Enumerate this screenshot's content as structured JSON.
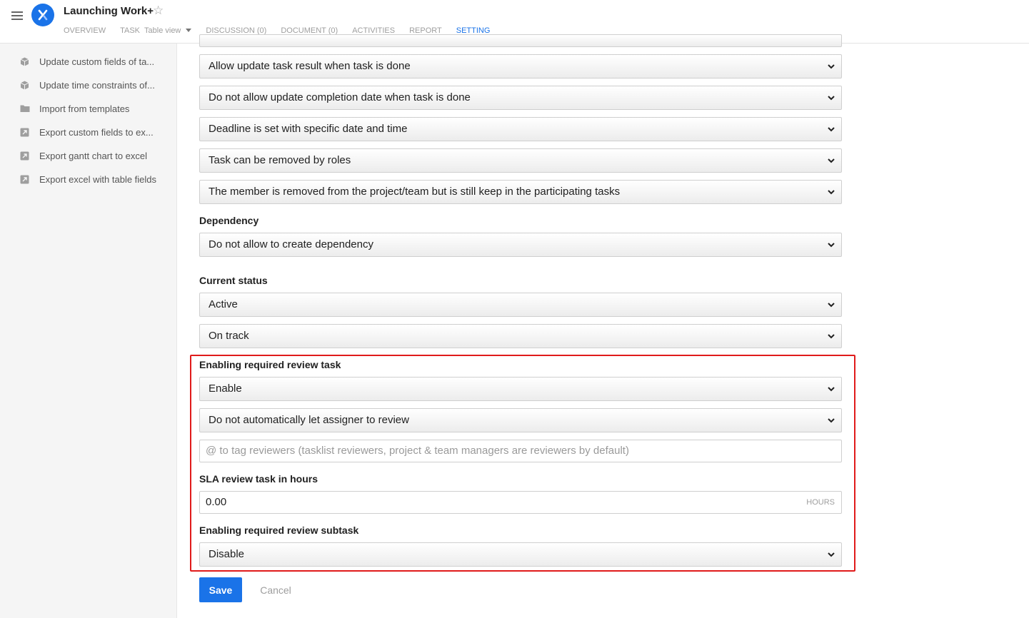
{
  "header": {
    "project_title": "Launching Work+",
    "tabs": [
      {
        "label": "OVERVIEW"
      },
      {
        "label": "TASK",
        "sub": "Table view"
      },
      {
        "label": "DISCUSSION (0)"
      },
      {
        "label": "DOCUMENT (0)"
      },
      {
        "label": "ACTIVITIES"
      },
      {
        "label": "REPORT"
      },
      {
        "label": "SETTING"
      }
    ],
    "active_tab": "SETTING",
    "accent_color": "#1a73e8"
  },
  "sidebar": {
    "items": [
      {
        "label": "Update custom fields of ta...",
        "icon": "cube-icon"
      },
      {
        "label": "Update time constraints of...",
        "icon": "cube-icon"
      },
      {
        "label": "Import from templates",
        "icon": "folder-icon"
      },
      {
        "label": "Export custom fields to ex...",
        "icon": "export-icon"
      },
      {
        "label": "Export gantt chart to excel",
        "icon": "export-icon"
      },
      {
        "label": "Export excel with table fields",
        "icon": "export-icon"
      }
    ]
  },
  "settings": {
    "selects_top": [
      "Allow update task result when task is done",
      "Do not allow update completion date when task is done",
      "Deadline is set with specific date and time",
      "Task can be removed by roles",
      "The member is removed from the project/team but is still keep in the participating tasks"
    ],
    "dependency": {
      "label": "Dependency",
      "value": "Do not allow to create dependency"
    },
    "current_status": {
      "label": "Current status",
      "values": [
        "Active",
        "On track"
      ]
    },
    "review_task": {
      "label": "Enabling required review task",
      "enable_value": "Enable",
      "assigner_value": "Do not automatically let assigner to review",
      "reviewers_placeholder": "@ to tag reviewers (tasklist reviewers, project & team managers are reviewers by default)"
    },
    "sla": {
      "label": "SLA review task in hours",
      "value": "0.00",
      "unit": "HOURS"
    },
    "review_subtask": {
      "label": "Enabling required review subtask",
      "value": "Disable"
    },
    "highlight_color": "#e01b1b"
  },
  "actions": {
    "save_label": "Save",
    "cancel_label": "Cancel"
  }
}
